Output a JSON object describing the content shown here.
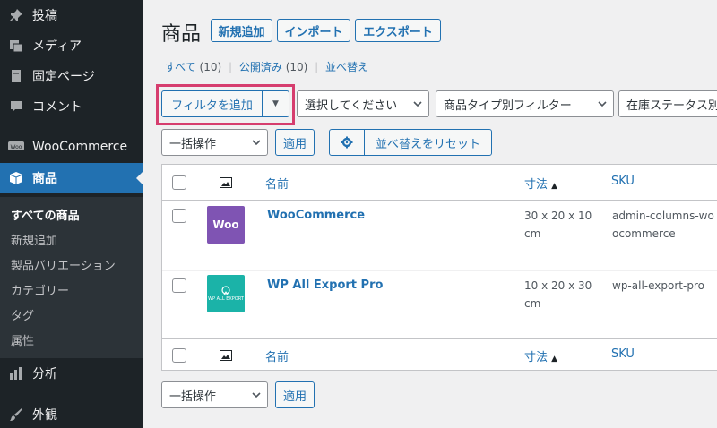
{
  "sidebar": {
    "items": [
      {
        "label": "投稿"
      },
      {
        "label": "メディア"
      },
      {
        "label": "固定ページ"
      },
      {
        "label": "コメント"
      },
      {
        "label": "WooCommerce"
      },
      {
        "label": "商品"
      },
      {
        "label": "分析"
      },
      {
        "label": "外観"
      }
    ],
    "submenu": [
      {
        "label": "すべての商品"
      },
      {
        "label": "新規追加"
      },
      {
        "label": "製品バリエーション"
      },
      {
        "label": "カテゴリー"
      },
      {
        "label": "タグ"
      },
      {
        "label": "属性"
      }
    ]
  },
  "header": {
    "title": "商品",
    "add_new": "新規追加",
    "import": "インポート",
    "export": "エクスポート"
  },
  "subsubsub": {
    "all": "すべて",
    "all_count": "(10)",
    "published": "公開済み",
    "published_count": "(10)",
    "sort": "並べ替え",
    "sep": "|"
  },
  "toolbar": {
    "add_filter": "フィルタを追加",
    "select_category": "選択してください",
    "product_type_filter": "商品タイプ別フィルター",
    "stock_status": "在庫ステータス別",
    "bulk_action": "一括操作",
    "apply": "適用",
    "reset_sort": "並べ替えをリセット"
  },
  "table": {
    "columns": {
      "name": "名前",
      "size": "寸法",
      "sku": "SKU"
    },
    "rows": [
      {
        "name": "WooCommerce",
        "size": "30 x 20 x 10 cm",
        "sku": "admin-columns-woocommerce",
        "thumb_text": "Woo"
      },
      {
        "name": "WP All Export Pro",
        "size": "10 x 20 x 30 cm",
        "sku": "wp-all-export-pro",
        "thumb_text": "WP ALL EXPORT"
      }
    ]
  },
  "bottom": {
    "bulk_action": "一括操作",
    "apply": "適用"
  },
  "colors": {
    "accent": "#2271b1",
    "sidebar": "#1d2327",
    "highlight": "#d63d6e",
    "woo": "#7f54b3",
    "wpae": "#1bb3a8"
  }
}
